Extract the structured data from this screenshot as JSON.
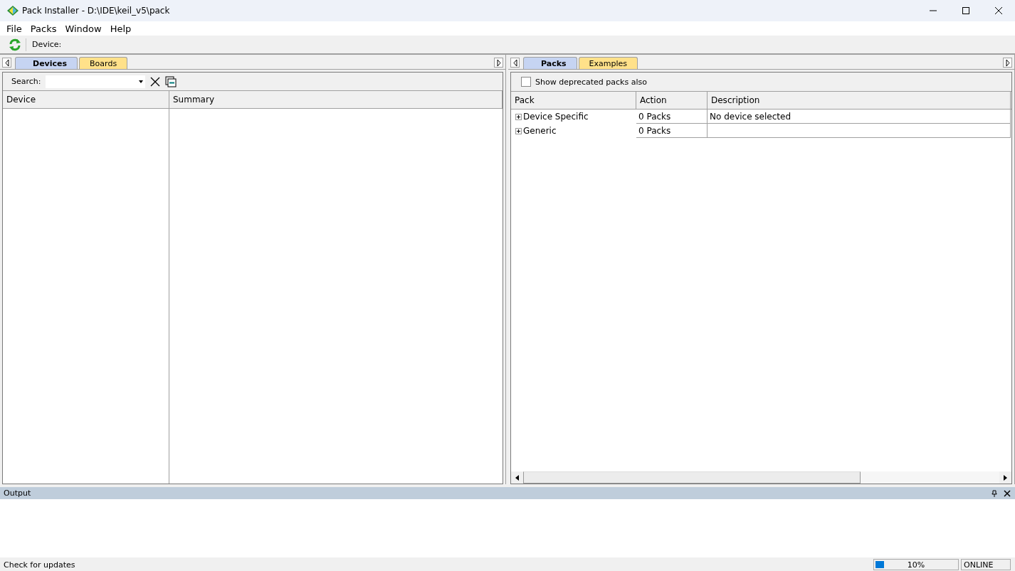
{
  "window": {
    "title": "Pack Installer - D:\\IDE\\keil_v5\\pack"
  },
  "menu": [
    "File",
    "Packs",
    "Window",
    "Help"
  ],
  "toolbar": {
    "device_label": "Device:"
  },
  "left_pane": {
    "tabs": [
      {
        "label": "Devices",
        "selected": true
      },
      {
        "label": "Boards",
        "selected": false
      }
    ],
    "search": {
      "label": "Search:"
    },
    "columns": [
      "Device",
      "Summary"
    ]
  },
  "right_pane": {
    "tabs": [
      {
        "label": "Packs",
        "selected": true
      },
      {
        "label": "Examples",
        "selected": false
      }
    ],
    "deprecated_checkbox": {
      "label": "Show deprecated packs also",
      "checked": false
    },
    "columns": [
      "Pack",
      "Action",
      "Description"
    ],
    "rows": [
      {
        "pack": "Device Specific",
        "action": "0 Packs",
        "description": "No device selected",
        "expanded": false
      },
      {
        "pack": "Generic",
        "action": "0 Packs",
        "expanded": false
      }
    ]
  },
  "output": {
    "title": "Output"
  },
  "status_bar": {
    "message": "Check for updates",
    "progress": {
      "level": 0.1,
      "reading": "10%"
    },
    "connection": "ONLINE"
  }
}
